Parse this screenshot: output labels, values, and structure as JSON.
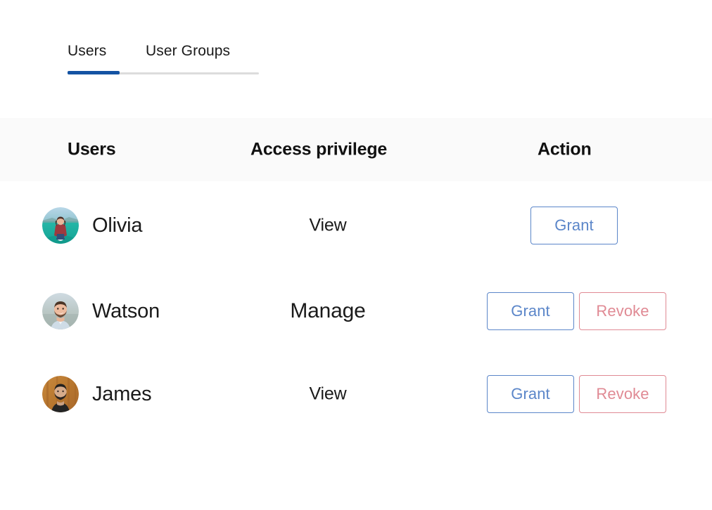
{
  "tabs": {
    "items": [
      {
        "label": "Users",
        "active": true
      },
      {
        "label": "User Groups",
        "active": false
      }
    ],
    "active_indicator_color": "#1453a3",
    "track_color": "#dcdcdc"
  },
  "table": {
    "header_background": "#fafafa",
    "columns": [
      {
        "key": "users",
        "label": "Users"
      },
      {
        "key": "privilege",
        "label": "Access privilege"
      },
      {
        "key": "action",
        "label": "Action"
      }
    ],
    "rows": [
      {
        "name": "Olivia",
        "avatar": "olivia-avatar",
        "privilege": "View",
        "actions": [
          {
            "label": "Grant",
            "kind": "grant",
            "color": "#5b86c9"
          }
        ]
      },
      {
        "name": "Watson",
        "avatar": "watson-avatar",
        "privilege": "Manage",
        "actions": [
          {
            "label": "Grant",
            "kind": "grant",
            "color": "#5b86c9"
          },
          {
            "label": "Revoke",
            "kind": "revoke",
            "color": "#e08a94"
          }
        ]
      },
      {
        "name": "James",
        "avatar": "james-avatar",
        "privilege": "View",
        "actions": [
          {
            "label": "Grant",
            "kind": "grant",
            "color": "#5b86c9"
          },
          {
            "label": "Revoke",
            "kind": "revoke",
            "color": "#e08a94"
          }
        ]
      }
    ]
  }
}
